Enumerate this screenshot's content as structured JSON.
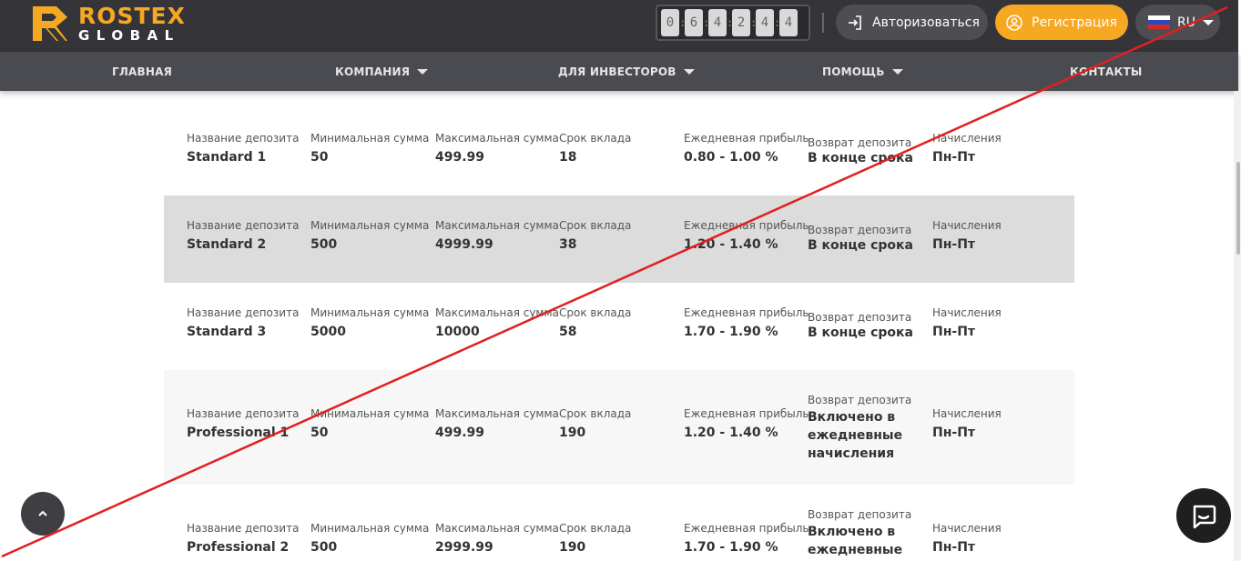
{
  "header": {
    "logo": {
      "name": "ROSTEX",
      "sub": "GLOBAL"
    },
    "counter": [
      "0",
      "6",
      "4",
      "2",
      "4",
      "4"
    ],
    "login_label": "Авторизоваться",
    "register_label": "Регистрация",
    "language": "RU"
  },
  "nav": {
    "items": [
      {
        "label": "ГЛАВНАЯ",
        "has_dropdown": false
      },
      {
        "label": "КОМПАНИЯ",
        "has_dropdown": true
      },
      {
        "label": "ДЛЯ ИНВЕСТОРОВ",
        "has_dropdown": true
      },
      {
        "label": "ПОМОЩЬ",
        "has_dropdown": true
      },
      {
        "label": "КОНТАКТЫ",
        "has_dropdown": false
      }
    ]
  },
  "labels": {
    "name": "Название депозита",
    "min": "Минимальная сумма",
    "max": "Максимальная сумма",
    "term": "Срок вклада",
    "daily": "Ежедневная прибыль",
    "return": "Возврат депозита",
    "accrual": "Начисления"
  },
  "plans": [
    {
      "name": "Standard 1",
      "min": "50",
      "max": "499.99",
      "term": "18",
      "daily": "0.80 - 1.00 %",
      "return": "В конце срока",
      "accrual": "Пн-Пт"
    },
    {
      "name": "Standard 2",
      "min": "500",
      "max": "4999.99",
      "term": "38",
      "daily": "1.20 - 1.40 %",
      "return": "В конце срока",
      "accrual": "Пн-Пт"
    },
    {
      "name": "Standard 3",
      "min": "5000",
      "max": "10000",
      "term": "58",
      "daily": "1.70 - 1.90 %",
      "return": "В конце срока",
      "accrual": "Пн-Пт"
    },
    {
      "name": "Professional 1",
      "min": "50",
      "max": "499.99",
      "term": "190",
      "daily": "1.20 - 1.40 %",
      "return": "Включено в ежедневные начисления",
      "accrual": "Пн-Пт"
    },
    {
      "name": "Professional 2",
      "min": "500",
      "max": "2999.99",
      "term": "190",
      "daily": "1.70 - 1.90 %",
      "return": "Включено в ежедневные",
      "accrual": "Пн-Пт"
    }
  ],
  "colors": {
    "accent": "#f6a823",
    "header_bg": "#353539",
    "nav_bg": "#4a4b50",
    "overlay_line": "#e02020"
  },
  "icons": {
    "login": "login-icon",
    "register": "user-circle-icon",
    "flag": "russia-flag-icon",
    "scroll_top": "chevron-up-icon",
    "chat": "chat-bubble-icon"
  }
}
